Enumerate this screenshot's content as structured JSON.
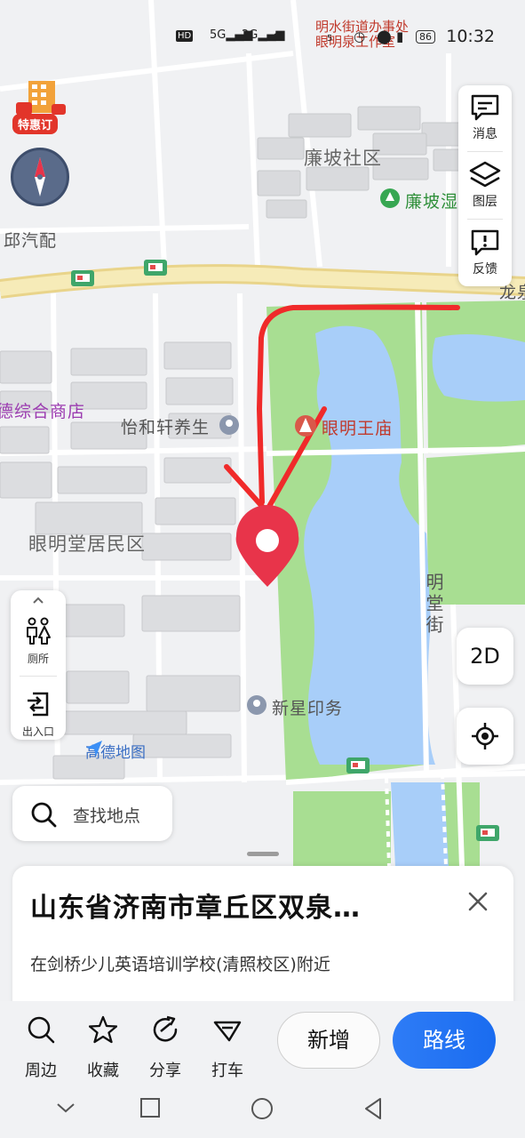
{
  "status_bar": {
    "time": "10:32",
    "battery": "86",
    "net_speed": "5",
    "notification_line1": "明水街道办事处",
    "notification_line2": "眼明泉工作室"
  },
  "promo": {
    "badge": "特惠订"
  },
  "right_panel": {
    "message_label": "消息",
    "layers_label": "图层",
    "feedback_label": "反馈"
  },
  "left_panel": {
    "toilet_label": "厕所",
    "entrance_label": "出入口"
  },
  "map": {
    "poi_lianpo_community": "廉坡社区",
    "poi_lianpo_wetland": "廉坡湿",
    "poi_qiu_auto": "邱汽配",
    "poi_longquan": "龙泉",
    "poi_general_store": "德综合商店",
    "poi_yihexuan": "怡和轩养生",
    "poi_yanming_temple": "眼明王庙",
    "poi_yanmingtang": "眼明堂居民区",
    "poi_mingtang_street": "明堂街",
    "poi_xinxing_print": "新星印务",
    "logo": "高德地图"
  },
  "controls": {
    "view_mode": "2D",
    "search_placeholder": "查找地点"
  },
  "place": {
    "title": "山东省济南市章丘区双泉…",
    "subtitle": "在剑桥少儿英语培训学校(清照校区)附近"
  },
  "actions": {
    "nearby": "周边",
    "favorite": "收藏",
    "share": "分享",
    "taxi": "打车",
    "add": "新增",
    "route": "路线"
  },
  "colors": {
    "water": "#a8cef9",
    "park": "#a6de8f",
    "road_main": "#f5e7a8",
    "pin": "#e8344a",
    "route_button": "#2374f5",
    "annotation": "#f02a2a"
  }
}
